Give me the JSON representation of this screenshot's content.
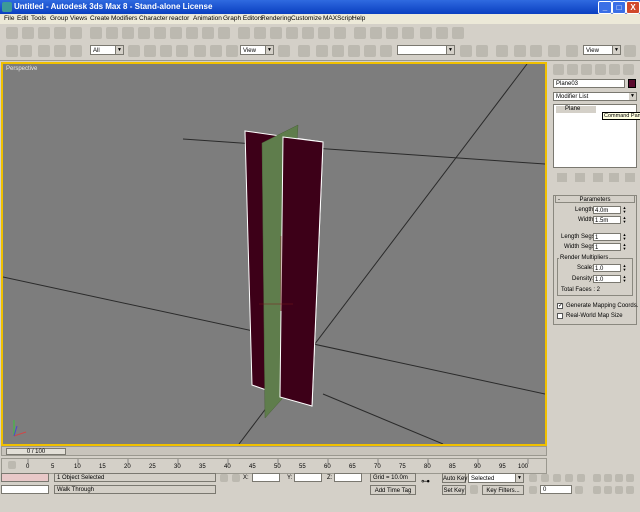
{
  "window": {
    "title": "Untitled - Autodesk 3ds Max 8  - Stand-alone License",
    "minimize": "_",
    "maximize": "□",
    "close": "X"
  },
  "menu": [
    "File",
    "Edit",
    "Tools",
    "Group",
    "Views",
    "Create",
    "Modifiers",
    "Character",
    "reactor",
    "Animation",
    "Graph Editors",
    "Rendering",
    "Customize",
    "MAXScript",
    "Help"
  ],
  "toolbar": {
    "selection_filter": "All",
    "ref_coord_left": "View",
    "ref_coord_right": "View",
    "named_selection": ""
  },
  "viewport": {
    "label": "Perspective",
    "colors": {
      "background": "#7d7d7d",
      "border": "#f0c000",
      "plane_a": "#3d0018",
      "plane_b": "#5f7d4c"
    }
  },
  "command_panel": {
    "object_name": "Plane03",
    "object_color": "#5a0a2e",
    "modifier_list": "Modifier List",
    "stack_item": "Plane",
    "tooltip": "Command Panel",
    "rollout_title": "Parameters",
    "length_label": "Length:",
    "length_value": "4.0m",
    "width_label": "Width:",
    "width_value": "1.5m",
    "length_segs_label": "Length Segs:",
    "length_segs_value": "1",
    "width_segs_label": "Width Segs:",
    "width_segs_value": "1",
    "render_mult_label": "Render Multipliers",
    "scale_label": "Scale:",
    "scale_value": "1.0",
    "density_label": "Density:",
    "density_value": "1.0",
    "total_faces": "Total Faces : 2",
    "gen_mapping": "Generate Mapping Coords.",
    "gen_mapping_checked": "✓",
    "real_world": "Real-World Map Size"
  },
  "timeline": {
    "slider_label": "0 / 100",
    "ticks": [
      "0",
      "5",
      "10",
      "15",
      "20",
      "25",
      "30",
      "35",
      "40",
      "45",
      "50",
      "55",
      "60",
      "65",
      "70",
      "75",
      "80",
      "85",
      "90",
      "95",
      "100"
    ]
  },
  "status": {
    "selected": "1 Object Selected",
    "prompt": "Walk Through",
    "x_label": "X:",
    "y_label": "Y:",
    "z_label": "Z:",
    "grid": "Grid = 10.0m",
    "add_time_tag": "Add Time Tag",
    "auto_key": "Auto Key",
    "set_key": "Set Key",
    "key_filter_dropdown": "Selected",
    "key_filters": "Key Filters...",
    "frame": "0"
  }
}
